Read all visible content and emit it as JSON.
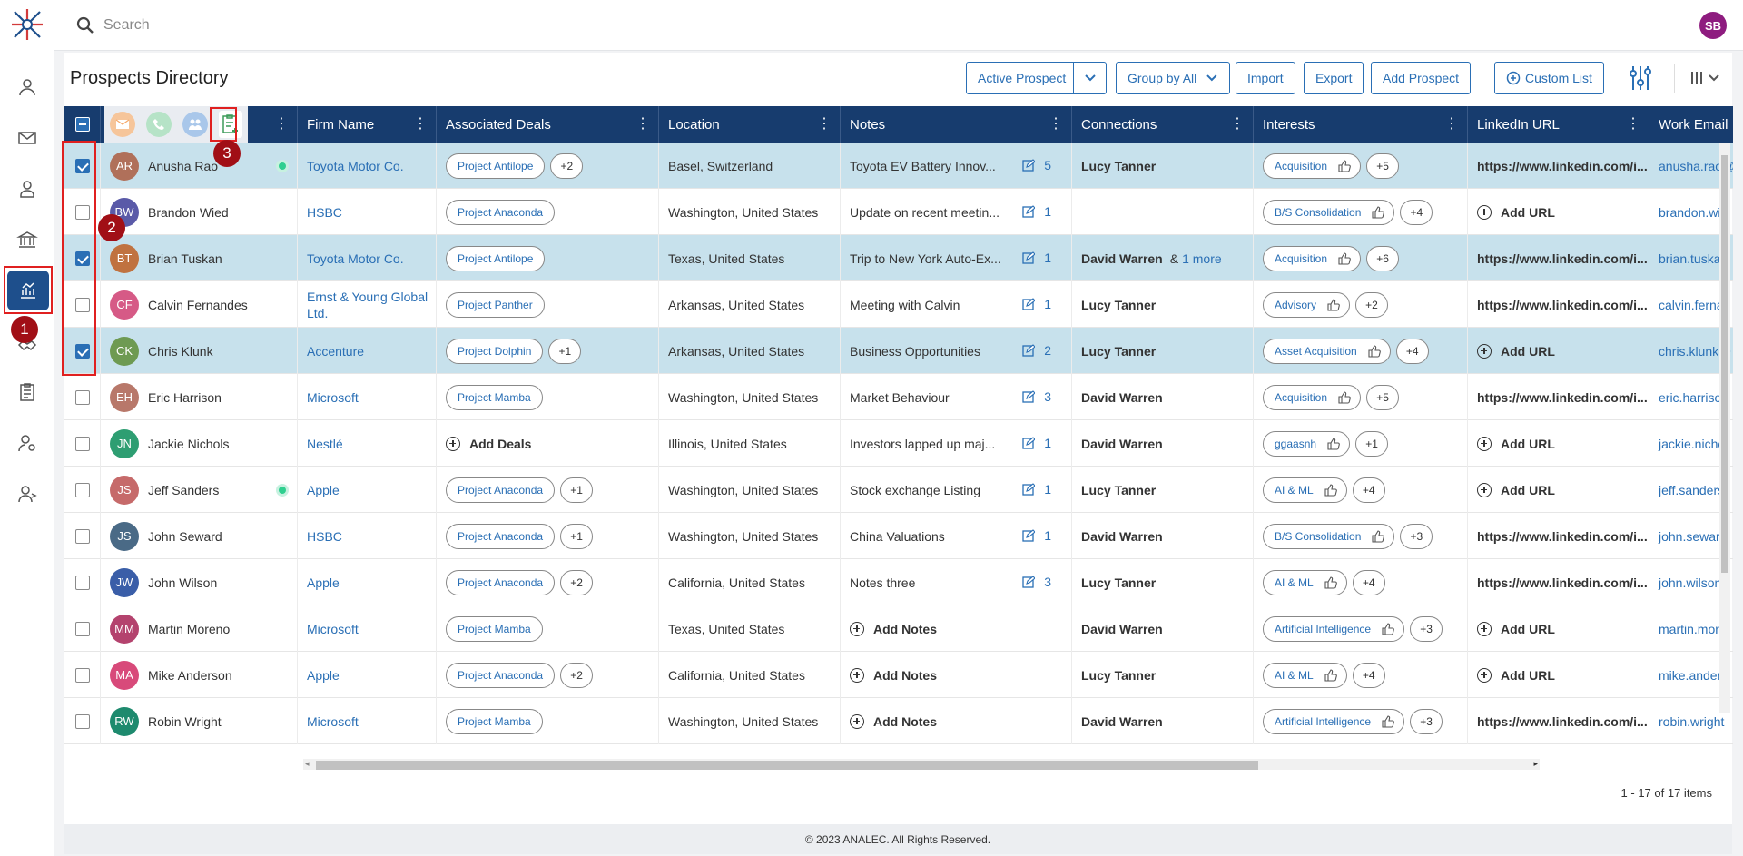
{
  "search": {
    "placeholder": "Search"
  },
  "user": {
    "initials": "SB"
  },
  "page": {
    "title": "Prospects Directory"
  },
  "toolbar": {
    "active_prospect": "Active Prospect",
    "group_by": "Group by All",
    "import": "Import",
    "export": "Export",
    "add_prospect": "Add Prospect",
    "custom_list": "Custom List"
  },
  "callouts": [
    "1",
    "2",
    "3"
  ],
  "columns": {
    "firm": "Firm Name",
    "deals": "Associated Deals",
    "location": "Location",
    "notes": "Notes",
    "connections": "Connections",
    "interests": "Interests",
    "linkedin": "LinkedIn URL",
    "email": "Work Email"
  },
  "labels": {
    "add_url": "Add URL",
    "add_notes": "Add Notes",
    "add_deals": "Add Deals",
    "and_more": "&",
    "more": "1 more"
  },
  "rows": [
    {
      "initials": "AR",
      "name": "Anusha Rao",
      "color": "#b0705a",
      "selected": true,
      "online": true,
      "firm": "Toyota Motor Co.",
      "deal": "Project Antilope",
      "deal_more": "+2",
      "location": "Basel, Switzerland",
      "notes": "Toyota EV Battery Innov...",
      "notes_count": "5",
      "connection": "Lucy Tanner",
      "connection_more": "",
      "interest": "Acquisition",
      "interest_more": "+5",
      "linkedin": "https://www.linkedin.com/i...",
      "email": "anusha.rao@"
    },
    {
      "initials": "BW",
      "name": "Brandon Wied",
      "color": "#5a5aa8",
      "selected": false,
      "online": false,
      "firm": "HSBC",
      "deal": "Project Anaconda",
      "deal_more": "",
      "location": "Washington, United States",
      "notes": "Update on recent meetin...",
      "notes_count": "1",
      "connection": "",
      "connection_more": "",
      "interest": "B/S Consolidation",
      "interest_more": "+4",
      "linkedin": "",
      "email": "brandon.wie"
    },
    {
      "initials": "BT",
      "name": "Brian Tuskan",
      "color": "#c07240",
      "selected": true,
      "online": false,
      "firm": "Toyota Motor Co.",
      "deal": "Project Antilope",
      "deal_more": "",
      "location": "Texas, United States",
      "notes": "Trip to New York Auto-Ex...",
      "notes_count": "1",
      "connection": "David Warren",
      "connection_more": "1 more",
      "interest": "Acquisition",
      "interest_more": "+6",
      "linkedin": "https://www.linkedin.com/i...",
      "email": "brian.tuskan"
    },
    {
      "initials": "CF",
      "name": "Calvin Fernandes",
      "color": "#d65a86",
      "selected": false,
      "online": false,
      "firm": "Ernst & Young Global Ltd.",
      "deal": "Project Panther",
      "deal_more": "",
      "location": "Arkansas, United States",
      "notes": "Meeting with Calvin",
      "notes_count": "1",
      "connection": "Lucy Tanner",
      "connection_more": "",
      "interest": "Advisory",
      "interest_more": "+2",
      "linkedin": "https://www.linkedin.com/i...",
      "email": "calvin.ferna"
    },
    {
      "initials": "CK",
      "name": "Chris Klunk",
      "color": "#6e9a52",
      "selected": true,
      "online": false,
      "firm": "Accenture",
      "deal": "Project Dolphin",
      "deal_more": "+1",
      "location": "Arkansas, United States",
      "notes": "Business Opportunities",
      "notes_count": "2",
      "connection": "Lucy Tanner",
      "connection_more": "",
      "interest": "Asset Acquisition",
      "interest_more": "+4",
      "linkedin": "",
      "email": "chris.klunk@"
    },
    {
      "initials": "EH",
      "name": "Eric Harrison",
      "color": "#b8786a",
      "selected": false,
      "online": false,
      "firm": "Microsoft",
      "deal": "Project Mamba",
      "deal_more": "",
      "location": "Washington, United States",
      "notes": "Market Behaviour",
      "notes_count": "3",
      "connection": "David Warren",
      "connection_more": "",
      "interest": "Acquisition",
      "interest_more": "+5",
      "linkedin": "https://www.linkedin.com/i...",
      "email": "eric.harrison"
    },
    {
      "initials": "JN",
      "name": "Jackie Nichols",
      "color": "#2e9e72",
      "selected": false,
      "online": false,
      "firm": "Nestlé",
      "deal": "",
      "deal_more": "",
      "location": "Illinois, United States",
      "notes": "Investors lapped up maj...",
      "notes_count": "1",
      "connection": "David Warren",
      "connection_more": "",
      "interest": "ggaasnh",
      "interest_more": "+1",
      "linkedin": "",
      "email": "jackie.nicho"
    },
    {
      "initials": "JS",
      "name": "Jeff Sanders",
      "color": "#c66a6a",
      "selected": false,
      "online": true,
      "firm": "Apple",
      "deal": "Project Anaconda",
      "deal_more": "+1",
      "location": "Washington, United States",
      "notes": "Stock exchange Listing",
      "notes_count": "1",
      "connection": "Lucy Tanner",
      "connection_more": "",
      "interest": "AI & ML",
      "interest_more": "+4",
      "linkedin": "",
      "email": "jeff.sanders"
    },
    {
      "initials": "JS",
      "name": "John Seward",
      "color": "#4a6a86",
      "selected": false,
      "online": false,
      "firm": "HSBC",
      "deal": "Project Anaconda",
      "deal_more": "+1",
      "location": "Washington, United States",
      "notes": "China Valuations",
      "notes_count": "1",
      "connection": "David Warren",
      "connection_more": "",
      "interest": "B/S Consolidation",
      "interest_more": "+3",
      "linkedin": "https://www.linkedin.com/i...",
      "email": "john.seward"
    },
    {
      "initials": "JW",
      "name": "John Wilson",
      "color": "#3a5ea8",
      "selected": false,
      "online": false,
      "firm": "Apple",
      "deal": "Project Anaconda",
      "deal_more": "+2",
      "location": "California, United States",
      "notes": "Notes three",
      "notes_count": "3",
      "connection": "Lucy Tanner",
      "connection_more": "",
      "interest": "AI & ML",
      "interest_more": "+4",
      "linkedin": "https://www.linkedin.com/i...",
      "email": "john.wilson"
    },
    {
      "initials": "MM",
      "name": "Martin Moreno",
      "color": "#b4436e",
      "selected": false,
      "online": false,
      "firm": "Microsoft",
      "deal": "Project Mamba",
      "deal_more": "",
      "location": "Texas, United States",
      "notes": "",
      "notes_count": "",
      "connection": "David Warren",
      "connection_more": "",
      "interest": "Artificial Intelligence",
      "interest_more": "+3",
      "linkedin": "",
      "email": "martin.more"
    },
    {
      "initials": "MA",
      "name": "Mike Anderson",
      "color": "#d84a7a",
      "selected": false,
      "online": false,
      "firm": "Apple",
      "deal": "Project Anaconda",
      "deal_more": "+2",
      "location": "California, United States",
      "notes": "",
      "notes_count": "",
      "connection": "Lucy Tanner",
      "connection_more": "",
      "interest": "AI & ML",
      "interest_more": "+4",
      "linkedin": "",
      "email": "mike.anders"
    },
    {
      "initials": "RW",
      "name": "Robin Wright",
      "color": "#1e8a6e",
      "selected": false,
      "online": false,
      "firm": "Microsoft",
      "deal": "Project Mamba",
      "deal_more": "",
      "location": "Washington, United States",
      "notes": "",
      "notes_count": "",
      "connection": "David Warren",
      "connection_more": "",
      "interest": "Artificial Intelligence",
      "interest_more": "+3",
      "linkedin": "https://www.linkedin.com/i...",
      "email": "robin.wright"
    }
  ],
  "pager": {
    "text": "1 - 17 of 17 items"
  },
  "footer": {
    "text": "© 2023 ANALEC. All Rights Reserved."
  },
  "colors": {
    "header": "#173c6e",
    "accent": "#2a6fb5",
    "selected_row": "#c7e1ec",
    "callout": "#a10f16"
  }
}
